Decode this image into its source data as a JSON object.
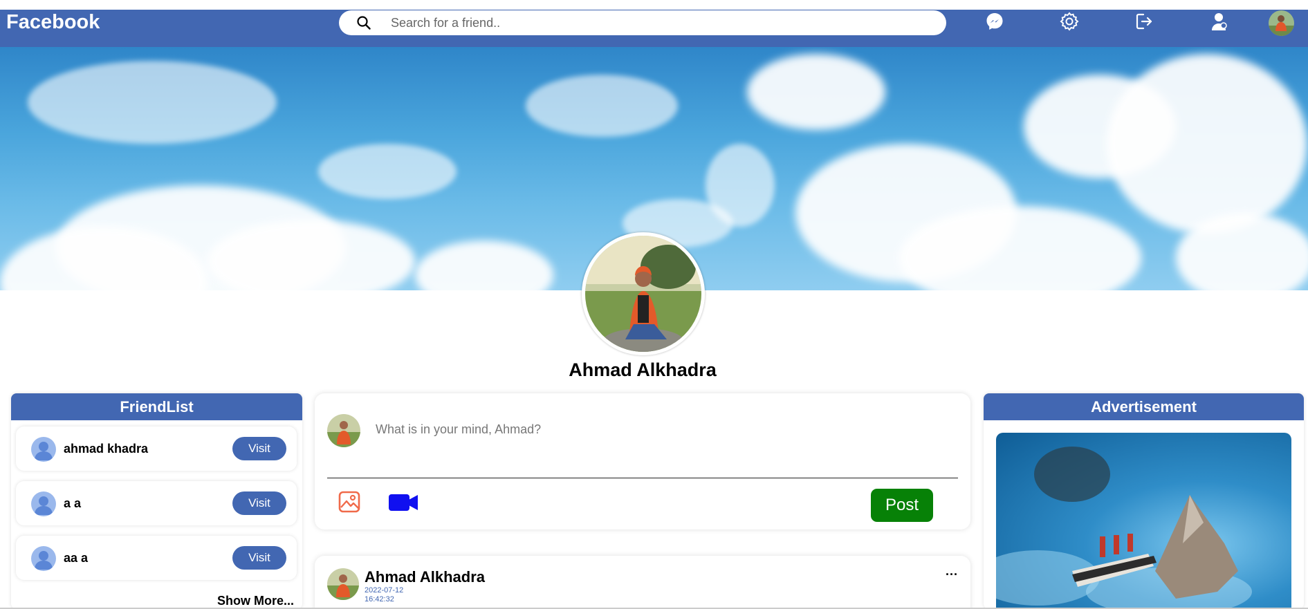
{
  "app": {
    "brand": "Facebook"
  },
  "search": {
    "placeholder": "Search for a friend.."
  },
  "nav": {
    "icons": [
      "messenger-icon",
      "settings-icon",
      "logout-icon",
      "profile-icon",
      "avatar"
    ]
  },
  "profile": {
    "name": "Ahmad Alkhadra"
  },
  "friend_list": {
    "title": "FriendList",
    "friends": [
      {
        "name": "ahmad khadra",
        "action": "Visit"
      },
      {
        "name": "a a",
        "action": "Visit"
      },
      {
        "name": "aa a",
        "action": "Visit"
      }
    ],
    "show_more": "Show More..."
  },
  "composer": {
    "placeholder": "What is in your mind, Ahmad?",
    "post_label": "Post"
  },
  "posts": [
    {
      "author": "Ahmad Alkhadra",
      "date": "2022-07-12",
      "time": "16:42:32",
      "menu": "..."
    }
  ],
  "ads": {
    "title": "Advertisement"
  },
  "colors": {
    "brand": "#4267b2",
    "post_button": "#078107",
    "video_icon": "#1010f0",
    "photo_icon": "#f06a4a"
  }
}
